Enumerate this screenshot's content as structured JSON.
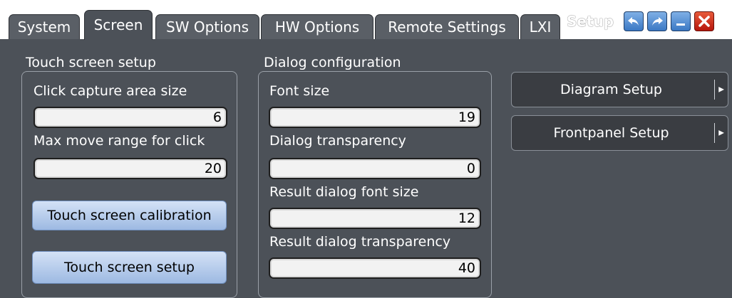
{
  "tabs": [
    {
      "label": "System"
    },
    {
      "label": "Screen"
    },
    {
      "label": "SW Options"
    },
    {
      "label": "HW Options"
    },
    {
      "label": "Remote Settings"
    },
    {
      "label": "LXI"
    }
  ],
  "window": {
    "title": "Setup",
    "buttons": [
      "undo-icon",
      "redo-icon",
      "minimize-icon",
      "close-icon"
    ]
  },
  "touch_screen_setup": {
    "title": "Touch screen setup",
    "click_capture_label": "Click capture area size",
    "click_capture_value": "6",
    "max_move_label": "Max move range for click",
    "max_move_value": "20",
    "calibration_button": "Touch screen calibration",
    "setup_button": "Touch screen setup"
  },
  "dialog_configuration": {
    "title": "Dialog configuration",
    "font_size_label": "Font size",
    "font_size_value": "19",
    "transparency_label": "Dialog transparency",
    "transparency_value": "0",
    "result_font_label": "Result dialog font size",
    "result_font_value": "12",
    "result_transparency_label": "Result dialog transparency",
    "result_transparency_value": "40"
  },
  "side_buttons": {
    "diagram_setup": "Diagram Setup",
    "frontpanel_setup": "Frontpanel Setup"
  },
  "colors": {
    "background": "#4c5158",
    "button_blue": "#b9cdea",
    "close_red": "#d0261a"
  }
}
